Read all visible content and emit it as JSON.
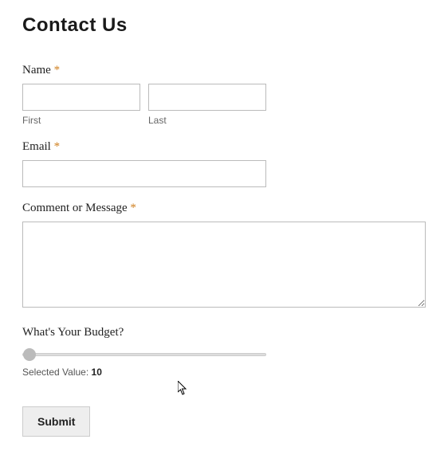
{
  "page": {
    "title": "Contact Us"
  },
  "form": {
    "name": {
      "label": "Name",
      "required": "*",
      "first": {
        "value": "",
        "sub_label": "First"
      },
      "last": {
        "value": "",
        "sub_label": "Last"
      }
    },
    "email": {
      "label": "Email",
      "required": "*",
      "value": ""
    },
    "message": {
      "label": "Comment or Message",
      "required": "*",
      "value": ""
    },
    "budget": {
      "label": "What's Your Budget?",
      "value": "10",
      "selected_label": "Selected Value: ",
      "selected_value": "10"
    },
    "submit": {
      "label": "Submit"
    }
  }
}
